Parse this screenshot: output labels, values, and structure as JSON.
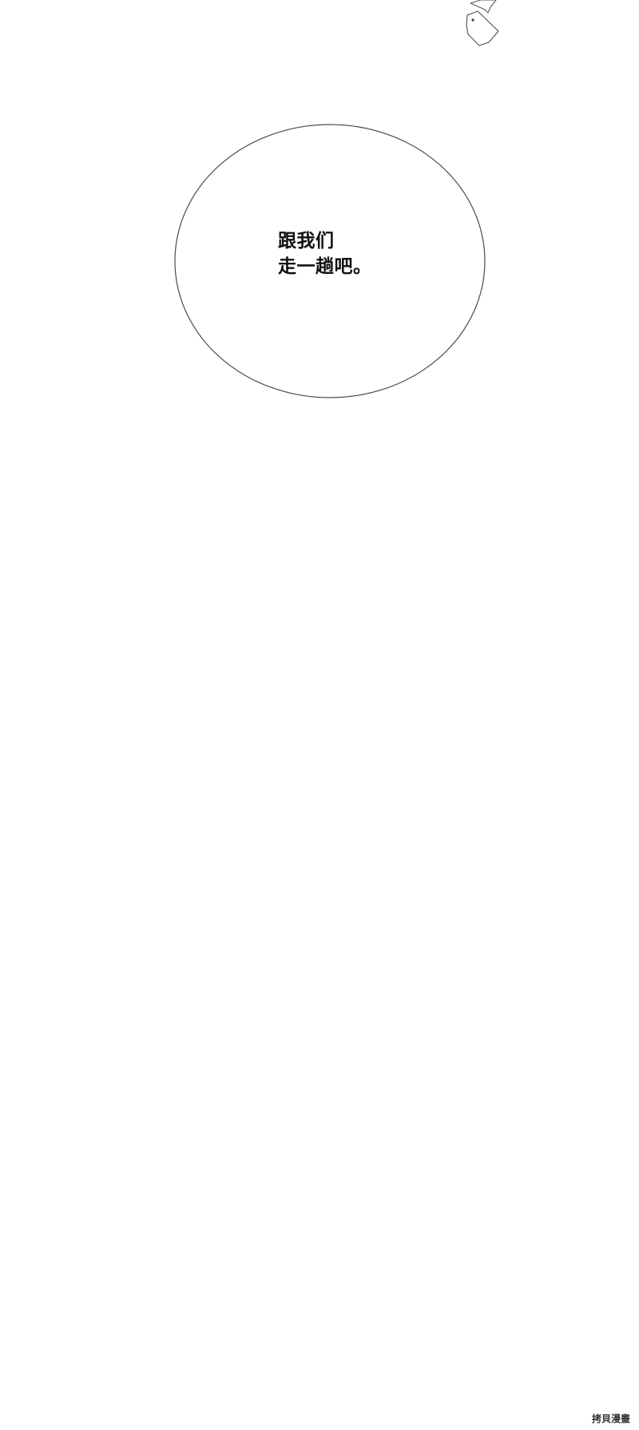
{
  "speech_bubble": {
    "lines": [
      "跟我们",
      "走一趟吧。"
    ]
  },
  "watermark": {
    "text": "拷貝漫畫"
  },
  "colors": {
    "background": "#ffffff",
    "ink": "#111111",
    "bubble_outline": "#4a4a4a"
  }
}
